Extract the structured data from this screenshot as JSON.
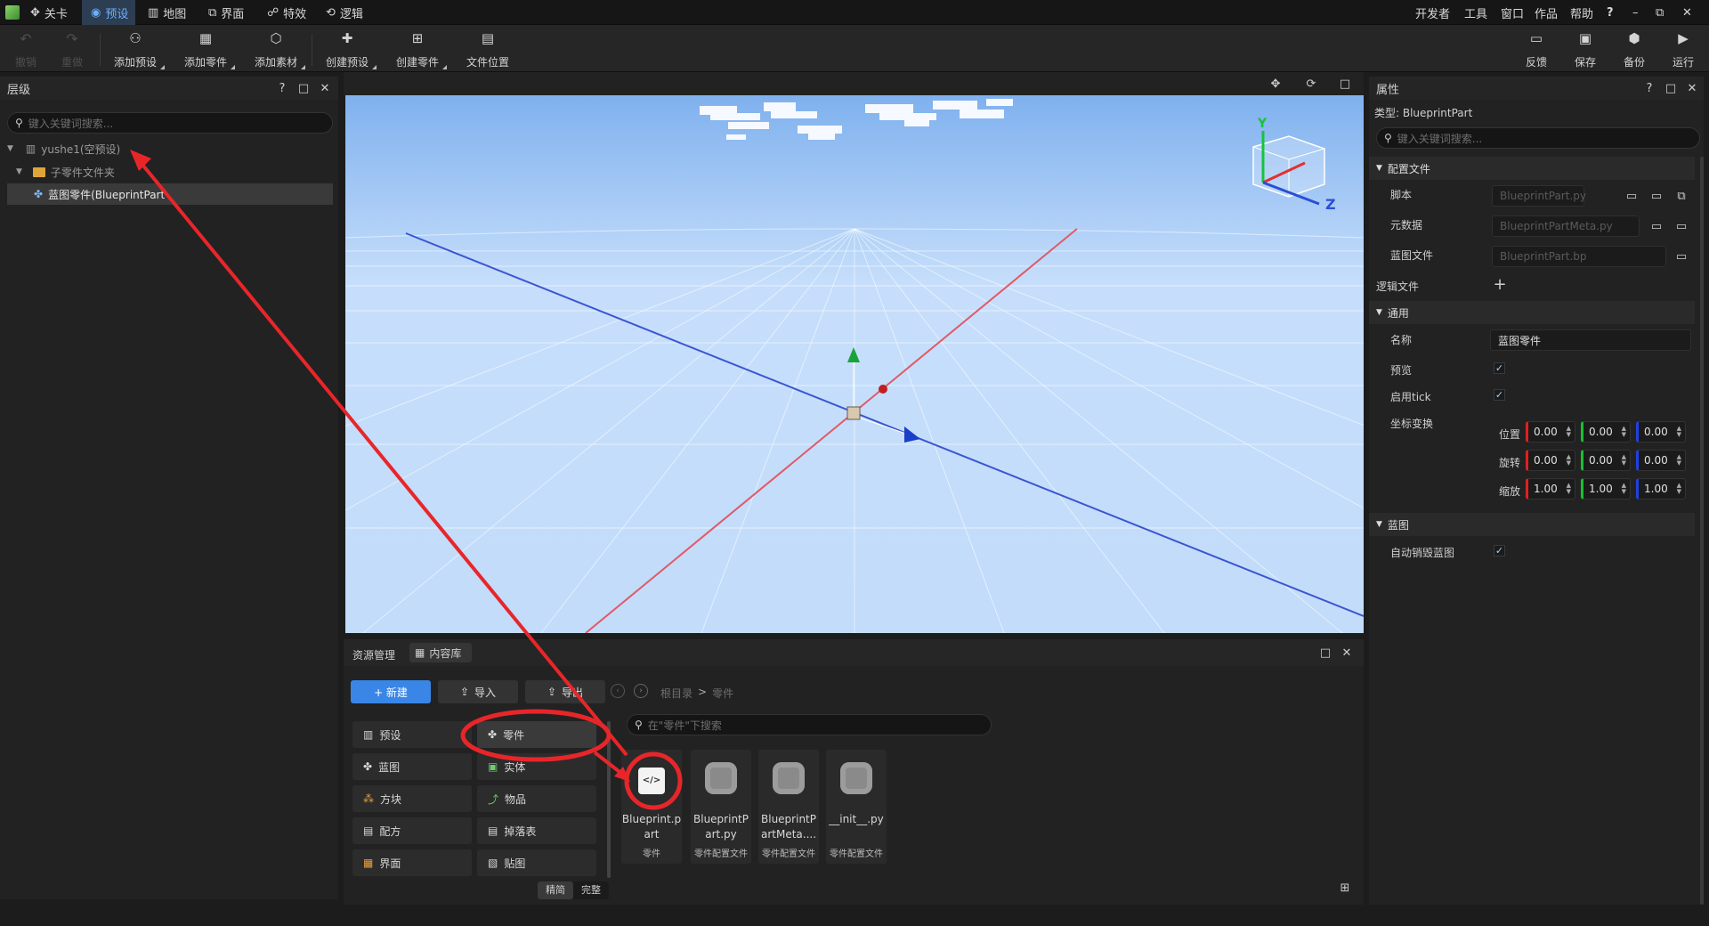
{
  "menubar": {
    "tabs": [
      {
        "label": "关卡",
        "active": false
      },
      {
        "label": "预设",
        "active": true
      },
      {
        "label": "地图",
        "active": false
      },
      {
        "label": "界面",
        "active": false
      },
      {
        "label": "特效",
        "active": false
      },
      {
        "label": "逻辑",
        "active": false
      }
    ],
    "right_menu": [
      "开发者",
      "工具",
      "窗口",
      "作品",
      "帮助",
      "?"
    ],
    "window_controls": [
      "–",
      "⧉",
      "✕"
    ]
  },
  "toolbar": {
    "undo": "撤销",
    "redo": "重做",
    "tools": [
      "添加预设",
      "添加零件",
      "添加素材",
      "创建预设",
      "创建零件",
      "文件位置"
    ],
    "right_tools": [
      "反馈",
      "保存",
      "备份",
      "运行"
    ]
  },
  "hierarchy": {
    "title": "层级",
    "search_placeholder": "键入关键词搜索...",
    "root": "yushe1(空预设)",
    "folder": "子零件文件夹",
    "item": "蓝图零件(BlueprintPart"
  },
  "properties": {
    "title": "属性",
    "type_label": "类型: BlueprintPart",
    "search_placeholder": "键入关键词搜索...",
    "config_section": "配置文件",
    "script_label": "脚本",
    "script_value": "BlueprintPart.py",
    "meta_label": "元数据",
    "meta_value": "BlueprintPartMeta.py",
    "bp_label": "蓝图文件",
    "bp_value": "BlueprintPart.bp",
    "logic_label": "逻辑文件",
    "general_section": "通用",
    "name_label": "名称",
    "name_value": "蓝图零件",
    "preview_label": "预览",
    "tick_label": "启用tick",
    "transform_label": "坐标变换",
    "pos_label": "位置",
    "rot_label": "旋转",
    "scale_label": "缩放",
    "pos": [
      "0.00",
      "0.00",
      "0.00"
    ],
    "rot": [
      "0.00",
      "0.00",
      "0.00"
    ],
    "scale": [
      "1.00",
      "1.00",
      "1.00"
    ],
    "blueprint_section": "蓝图",
    "autodestroy_label": "自动销毁蓝图",
    "check": "✓"
  },
  "viewport": {
    "gizmo_y": "Y",
    "gizmo_z": "Z"
  },
  "assets": {
    "tab_manager": "资源管理",
    "tab_library": "内容库",
    "new_btn": "+ 新建",
    "import_btn": "导入",
    "export_btn": "导出",
    "breadcrumb_root": "根目录",
    "breadcrumb_sep": ">",
    "breadcrumb_leaf": "零件",
    "search_placeholder": "在\"零件\"下搜索",
    "categories_left": [
      "预设",
      "蓝图",
      "方块",
      "配方",
      "界面"
    ],
    "categories_right": [
      "零件",
      "实体",
      "物品",
      "掉落表",
      "贴图"
    ],
    "items": [
      {
        "name": "Blueprint.part",
        "type": "零件"
      },
      {
        "name": "BlueprintPart.py",
        "type": "零件配置文件"
      },
      {
        "name": "BlueprintPartMeta....",
        "type": "零件配置文件"
      },
      {
        "name": "__init__.py",
        "type": "零件配置文件"
      }
    ],
    "mode_simple": "精简",
    "mode_full": "完整"
  },
  "colors": {
    "accent": "#3a86e6",
    "annotation": "#e8262a",
    "sky_top": "#7fb1ee",
    "sky_bottom": "#c6defb",
    "axis_x": "#e05a66",
    "axis_z": "#3b56d0"
  }
}
